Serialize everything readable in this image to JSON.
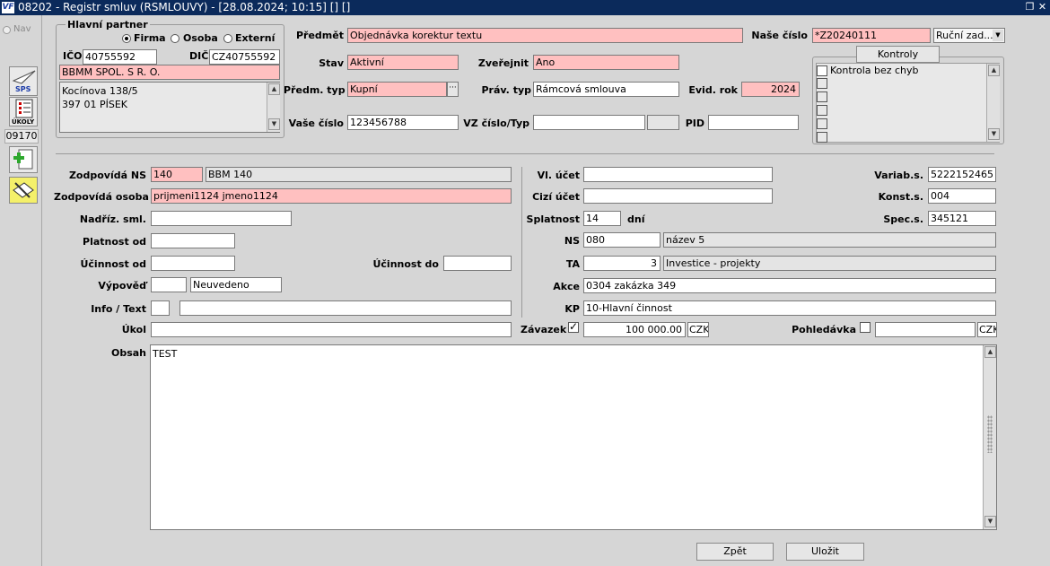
{
  "window": {
    "logo_text": "VF",
    "title": "08202 - Registr smluv (RSMLOUVY) - [28.08.2024; 10:15] [] []"
  },
  "sidebar": {
    "nav_label": "Nav",
    "sps_label": "SPS",
    "ukoly_label": "ÚKOLY",
    "record_number": "09170"
  },
  "partner": {
    "group_label": "Hlavní partner",
    "type_options": [
      "Firma",
      "Osoba",
      "Externí"
    ],
    "type_selected": "Firma",
    "ico_label": "IČO",
    "ico": "40755592",
    "dic_label": "DIČ",
    "dic": "CZ40755592",
    "name": "BBMM SPOL. S R. O.",
    "address_line1": "Kocínova 138/5",
    "address_line2": "397 01 PÍSEK"
  },
  "header": {
    "predmet_label": "Předmět",
    "predmet": "Objednávka korektur textu",
    "nase_cislo_label": "Naše číslo",
    "nase_cislo": "*Z20240111",
    "rucni_zad": "Ruční zad...",
    "stav_label": "Stav",
    "stav": "Aktivní",
    "zverejnit_label": "Zveřejnit",
    "zverejnit": "Ano",
    "predm_typ_label": "Předm. typ",
    "predm_typ": "Kupní",
    "prav_typ_label": "Práv. typ",
    "prav_typ": "Rámcová smlouva",
    "evid_rok_label": "Evid. rok",
    "evid_rok": "2024",
    "vase_cislo_label": "Vaše číslo",
    "vase_cislo": "123456788",
    "vz_label": "VZ číslo/Typ",
    "vz_cislo": "",
    "vz_typ": "",
    "pid_label": "PID",
    "pid": ""
  },
  "kontroly": {
    "button_label": "Kontroly",
    "items": [
      "Kontrola bez chyb",
      "",
      "",
      "",
      "",
      ""
    ]
  },
  "left": {
    "zodp_ns_label": "Zodpovídá NS",
    "zodp_ns_code": "140",
    "zodp_ns_name": "BBM 140",
    "zodp_osoba_label": "Zodpovídá osoba",
    "zodp_osoba": "prijmeni1124 jmeno1124",
    "nadriz_label": "Nadříz. sml.",
    "nadriz": "",
    "platnost_label": "Platnost od",
    "platnost": "",
    "ucinnost_od_label": "Účinnost od",
    "ucinnost_od": "",
    "ucinnost_do_label": "Účinnost do",
    "ucinnost_do": "",
    "vypoved_label": "Výpověď",
    "vypoved_code": "",
    "vypoved": "Neuvedeno",
    "info_label": "Info / Text",
    "info_code": "",
    "info_text": "",
    "ukol_label": "Úkol",
    "ukol": ""
  },
  "right": {
    "vl_ucet_label": "Vl. účet",
    "vl_ucet": "",
    "cizi_ucet_label": "Cizí účet",
    "cizi_ucet": "",
    "splatnost_label": "Splatnost",
    "splatnost": "14",
    "dni_label": "dní",
    "variab_label": "Variab.s.",
    "variab": "5222152465",
    "konst_label": "Konst.s.",
    "konst": "004",
    "spec_label": "Spec.s.",
    "spec": "345121",
    "ns_label": "NS",
    "ns_code": "080",
    "ns_name": "název 5",
    "ta_label": "TA",
    "ta_code": "3",
    "ta_name": "Investice - projekty",
    "akce_label": "Akce",
    "akce": "0304 zakázka 349",
    "kp_label": "KP",
    "kp": "10-Hlavní činnost",
    "zavazek_label": "Závazek",
    "zavazek_checked": true,
    "zavazek_amount": "100 000.00",
    "zavazek_currency": "CZK",
    "pohledavka_label": "Pohledávka",
    "pohledavka_checked": false,
    "pohledavka_amount": "",
    "pohledavka_currency": "CZK"
  },
  "obsah": {
    "label": "Obsah",
    "text": "TEST"
  },
  "footer": {
    "back_label": "Zpět",
    "save_label": "Uložit"
  }
}
